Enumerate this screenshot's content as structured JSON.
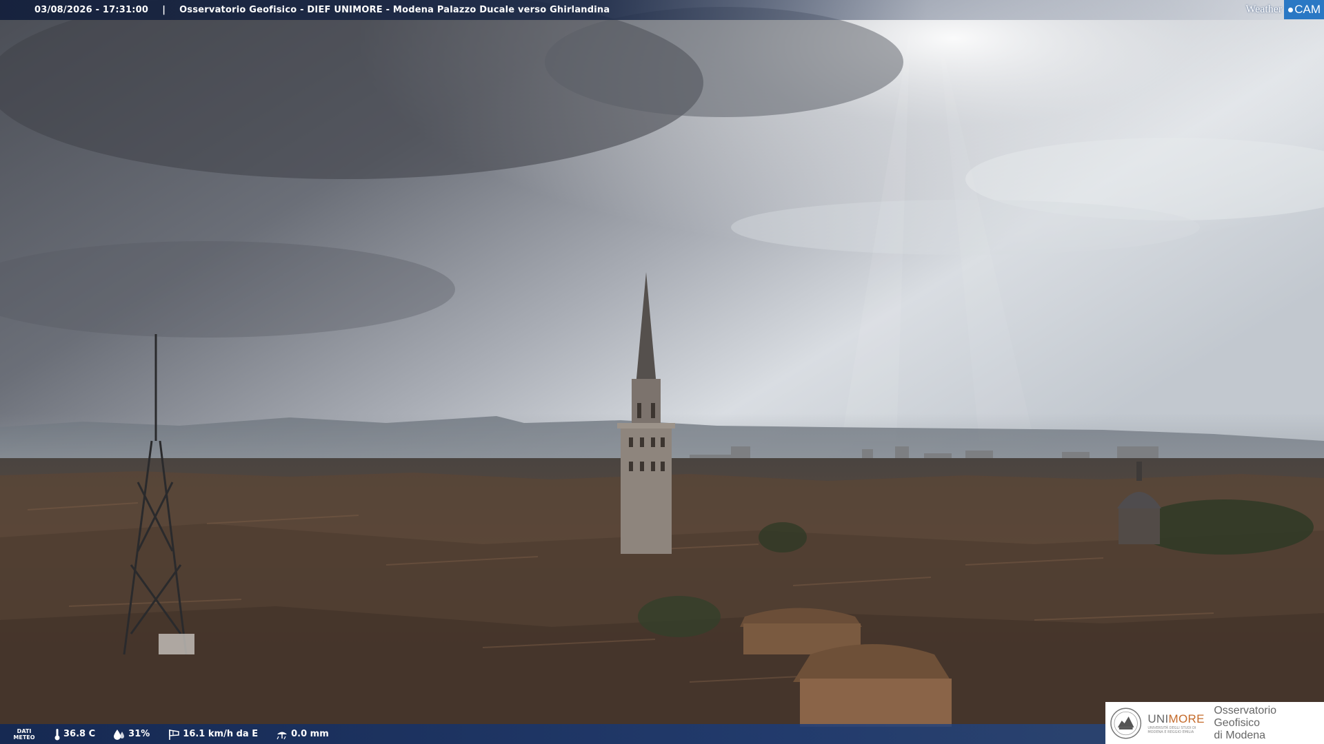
{
  "header": {
    "datetime": "03/08/2026 - 17:31:00",
    "separator": "|",
    "title": "Osservatorio Geofisico - DIEF UNIMORE - Modena Palazzo Ducale verso Ghirlandina"
  },
  "logo": {
    "weather": "Weather",
    "cam": "CAM"
  },
  "weather_bar": {
    "label_line1": "DATI",
    "label_line2": "METEO",
    "temperature": "36.8 C",
    "humidity": "31%",
    "wind": "16.1 km/h da E",
    "rain": "0.0 mm",
    "icons": [
      "thermometer-icon",
      "humidity-drop-icon",
      "wind-icon",
      "rain-icon"
    ]
  },
  "institution": {
    "name_part1": "UNI",
    "name_part2": "MORE",
    "subtitle": "UNIVERSITÀ DEGLI STUDI DI MODENA E REGGIO EMILIA",
    "observatory_line1": "Osservatorio Geofisico",
    "observatory_line2": "di Modena"
  },
  "colors": {
    "accent_blue": "#2a78c4",
    "bar_navy": "#1c3c78",
    "unimore_orange": "#c46a2a"
  }
}
